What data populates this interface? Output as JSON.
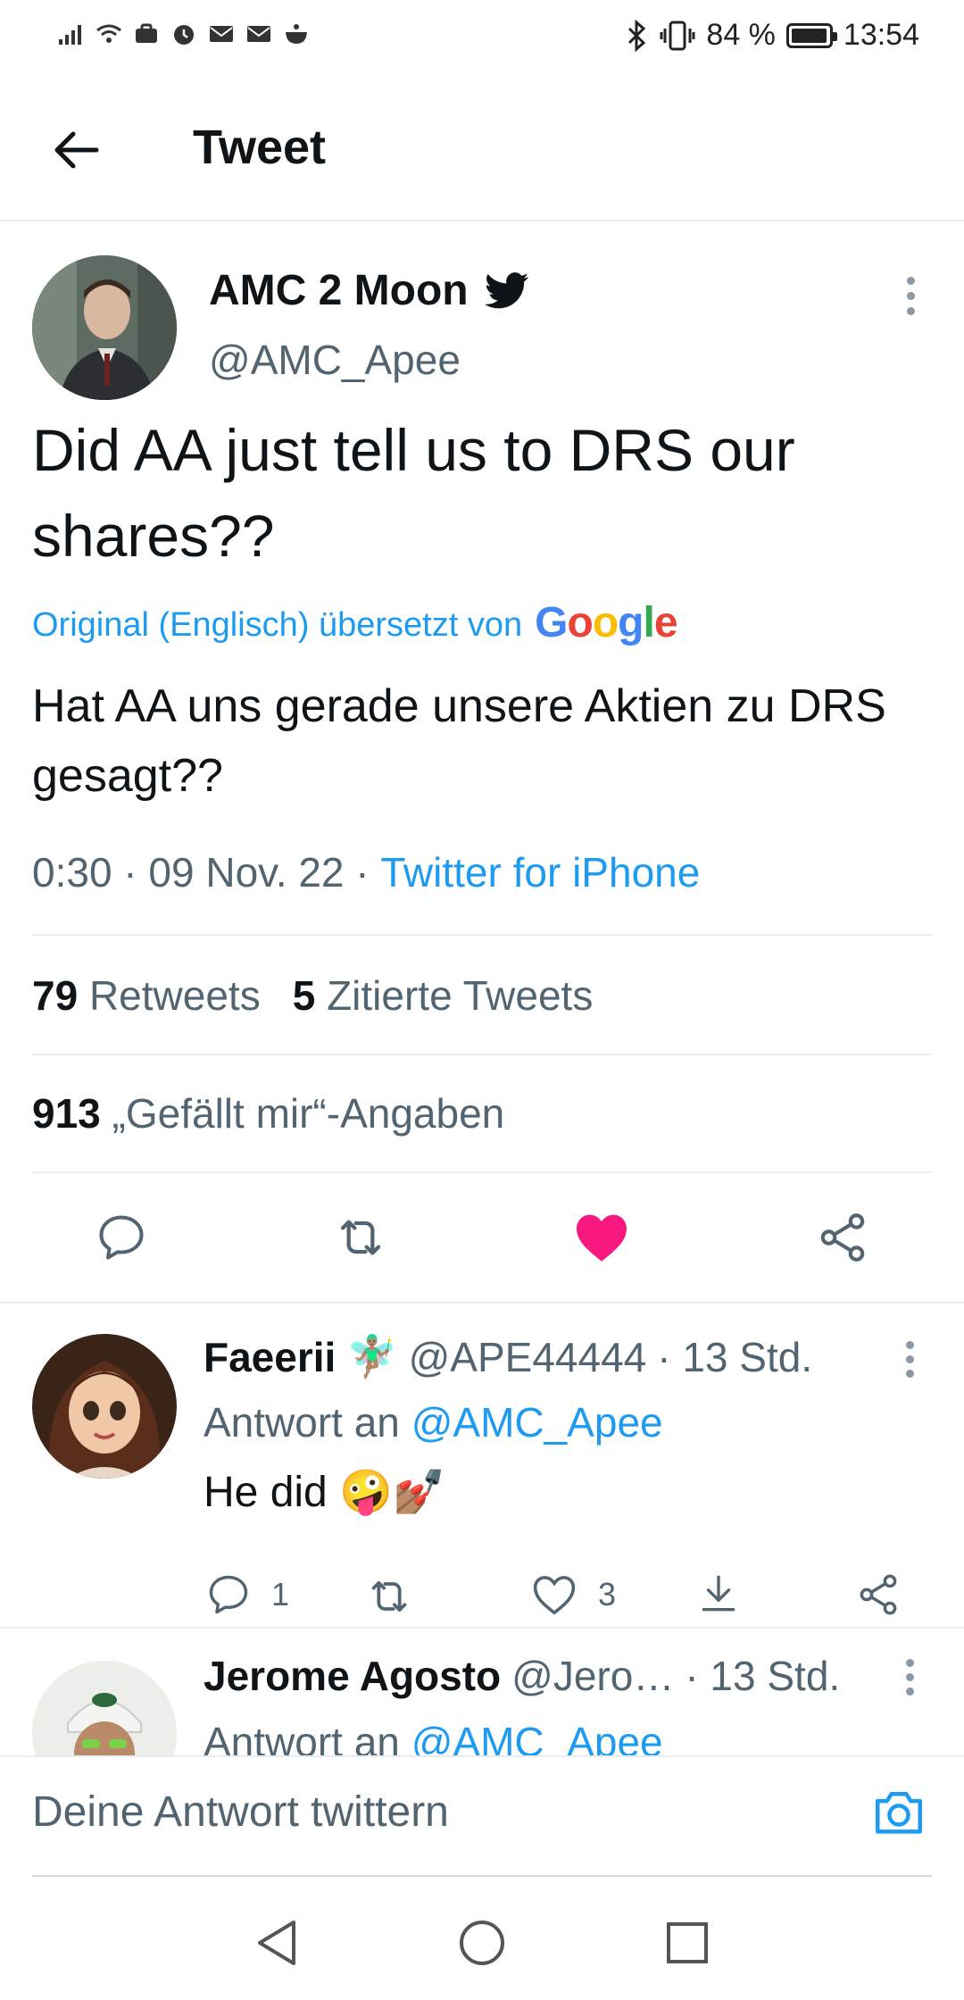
{
  "status_bar": {
    "battery_text": "84 %",
    "battery_level": 0.84,
    "time": "13:54"
  },
  "header": {
    "title": "Tweet"
  },
  "tweet": {
    "author_name": "AMC 2 Moon",
    "author_handle": "@AMC_Apee",
    "text": "Did AA just tell us to DRS our shares??",
    "translated_label": "Original (Englisch) übersetzt von",
    "translator_logo": "Google",
    "translation": "Hat AA uns gerade unsere Aktien zu DRS gesagt??",
    "time": "0:30",
    "date": "09 Nov. 22",
    "separator": " · ",
    "source": "Twitter for iPhone",
    "retweets_count": "79",
    "retweets_label": "Retweets",
    "quotes_count": "5",
    "quotes_label": "Zitierte Tweets",
    "likes_count": "913",
    "likes_label": "„Gefällt mir“-Angaben",
    "liked": true
  },
  "replies": [
    {
      "name": "Faeerii",
      "name_emoji": "🧚🏽‍♂️",
      "handle": "@APE44444",
      "time": "· 13 Std.",
      "reply_to_label": "Antwort an",
      "reply_to_handle": "@AMC_Apee",
      "text": "He did",
      "text_emojis": "🤪💅🏽",
      "reply_count": "1",
      "like_count": "3"
    },
    {
      "name": "Jerome Agosto",
      "handle": "@Jero…",
      "time": "· 13 Std.",
      "reply_to_label": "Antwort an",
      "reply_to_handle": "@AMC_Apee"
    }
  ],
  "compose": {
    "placeholder": "Deine Antwort twittern"
  },
  "colors": {
    "accent": "#1d9bf0",
    "like": "#f91880",
    "muted": "#536471"
  }
}
